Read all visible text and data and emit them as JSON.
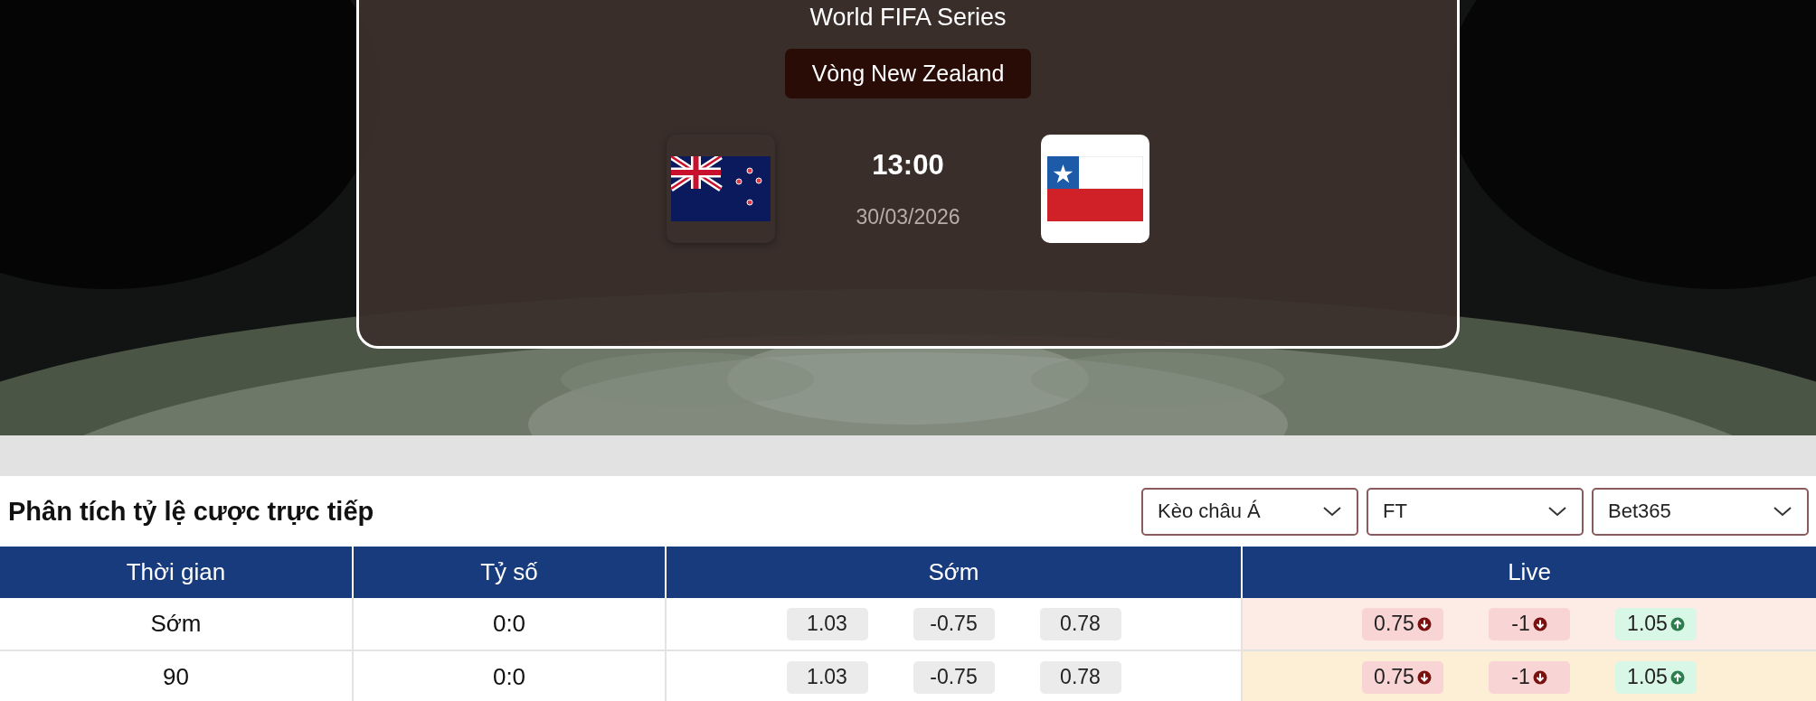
{
  "match": {
    "competition": "World FIFA Series",
    "round": "Vòng New Zealand",
    "time": "13:00",
    "date": "30/03/2026"
  },
  "odds": {
    "title": "Phân tích tỷ lệ cược trực tiếp",
    "filters": [
      {
        "value": "Kèo châu Á"
      },
      {
        "value": "FT"
      },
      {
        "value": "Bet365"
      }
    ],
    "columns": [
      "Thời gian",
      "Tỷ số",
      "Sớm",
      "Live"
    ],
    "rows": [
      {
        "time": "Sớm",
        "score": "0:0",
        "early": [
          "1.03",
          "-0.75",
          "0.78"
        ],
        "color": "#fdece6",
        "live": [
          {
            "value": "0.75",
            "up": false
          },
          {
            "value": "-1",
            "up": false
          },
          {
            "value": "1.05",
            "up": true
          }
        ]
      },
      {
        "time": "90",
        "score": "0:0",
        "early": [
          "1.03",
          "-0.75",
          "0.78"
        ],
        "color": "#fdeed6",
        "live": [
          {
            "value": "0.75",
            "up": false
          },
          {
            "value": "-1",
            "up": false
          },
          {
            "value": "1.05",
            "up": true
          }
        ]
      }
    ]
  }
}
